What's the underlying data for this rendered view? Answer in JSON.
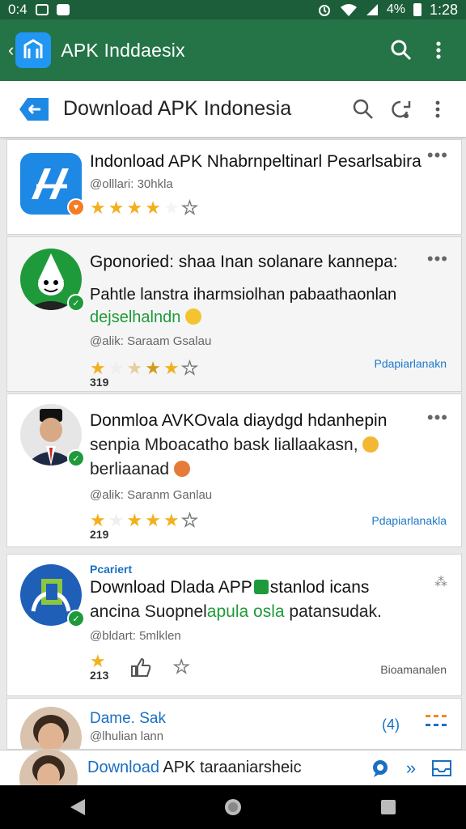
{
  "status_bar": {
    "left_text": "0:4",
    "battery": "4%",
    "time": "1:28"
  },
  "appbar": {
    "title": "APK Inddaesix"
  },
  "toolbar": {
    "title": "Download APK Indonesia"
  },
  "posts": [
    {
      "title": "Indonload APK Nhabrnpeltinarl Pesarlsabira",
      "meta": "@olllari: 30hkla",
      "rating": 3.5
    },
    {
      "title": "Gponoried: shaa Inan solanare kannepa:",
      "body_line1": "Pahtle lanstra iharmsiolhan pabaathaonlan",
      "body_line2": "dejselhalndn",
      "meta": "@alik: Saraam Gsalau",
      "rating_count": "319",
      "action": "Pdapiarlanakn"
    },
    {
      "title": "Donmloa AVKOvala diaydgd hdanhepin",
      "body_line1": "senpia Mboacatho bask liallaakasn,",
      "body_line2": "berliaanad",
      "meta": "@alik: Saranm Ganlau",
      "rating_count": "219",
      "action": "Pdapiarlanakla"
    },
    {
      "tag": "Pcariert",
      "title_part1": "Download Dlada APP",
      "title_part2": "stanlod icans",
      "body_part1": "ancina Suopnel",
      "body_part2": "apula osla",
      "body_part3": "patansudak.",
      "meta": "@bldart: 5mlklen",
      "rating_count": "213",
      "action": "Bioamanalen"
    },
    {
      "name": "Dame. Sak",
      "meta": "@lhulian lann",
      "count": "(4)"
    }
  ],
  "bottom_bar": {
    "text_blue": "Download",
    "text_rest": "APK taraaniarsheic"
  },
  "colors": {
    "appbar": "#247447",
    "statusbar": "#1c5e3a",
    "accent": "#1b7acb",
    "star": "#f2b01e"
  }
}
